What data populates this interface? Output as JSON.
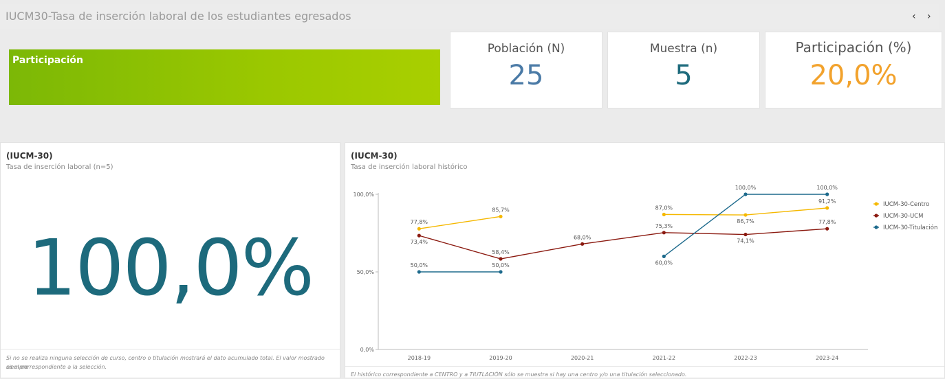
{
  "header": {
    "title": "IUCM30-Tasa de inserción laboral de los estudiantes egresados",
    "prev_icon": "‹",
    "next_icon": "›"
  },
  "banner": {
    "label": "Participación"
  },
  "kpis": [
    {
      "label": "Población (N)",
      "value": "25",
      "color": "#4a7aa6"
    },
    {
      "label": "Muestra (n)",
      "value": "5",
      "color": "#1d6a7c"
    },
    {
      "label": "Participación (%)",
      "value": "20,0%",
      "color": "#f2a22c"
    }
  ],
  "left_panel": {
    "title": "(IUCM-30)",
    "subtitle": "Tasa de inserción laboral (n=5)",
    "value": "100,0%",
    "footnote_line1": "Si no se realiza ninguna selección de curso, centro o titulación mostrará el dato acumulado total. El valor mostrado siempre",
    "footnote_line2": "es el correspondiente a la selección."
  },
  "right_panel": {
    "title": "(IUCM-30)",
    "subtitle": "Tasa de inserción laboral histórico",
    "footnote": "El histórico correspondiente a CENTRO y a TIUTLACIÓN sólo se muestra si hay una centro y/o una titulación seleccionado."
  },
  "chart_data": {
    "type": "line",
    "categories": [
      "2018-19",
      "2019-20",
      "2020-21",
      "2021-22",
      "2022-23",
      "2023-24"
    ],
    "y_ticks": [
      "0,0%",
      "50,0%",
      "100,0%"
    ],
    "ylim": [
      0,
      100
    ],
    "grid": false,
    "legend_position": "right",
    "series": [
      {
        "name": "IUCM-30-Centro",
        "color": "#f5b800",
        "values": [
          77.8,
          85.7,
          null,
          87.0,
          86.7,
          91.2
        ],
        "labels": [
          "77,8%",
          "85,7%",
          "",
          "87,0%",
          "86,7%",
          "91,2%"
        ]
      },
      {
        "name": "IUCM-30-UCM",
        "color": "#8b1a10",
        "values": [
          73.4,
          58.4,
          68.0,
          75.3,
          74.1,
          77.8
        ],
        "labels": [
          "73,4%",
          "58,4%",
          "68,0%",
          "75,3%",
          "74,1%",
          "77,8%"
        ]
      },
      {
        "name": "IUCM-30-Titulación",
        "color": "#1d6a8c",
        "values": [
          50.0,
          50.0,
          null,
          60.0,
          100.0,
          100.0
        ],
        "labels": [
          "50,0%",
          "50,0%",
          "",
          "60,0%",
          "100,0%",
          "100,0%"
        ]
      }
    ]
  }
}
